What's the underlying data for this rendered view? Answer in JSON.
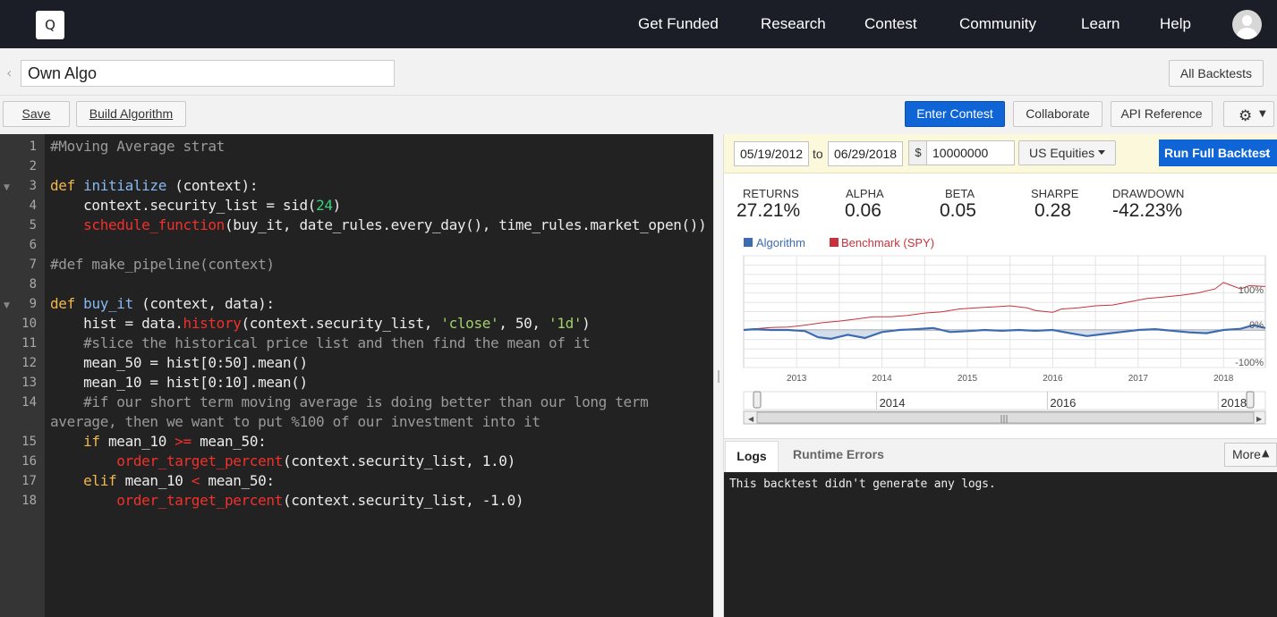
{
  "nav": {
    "logo": "Q",
    "links": [
      "Get Funded",
      "Research",
      "Contest",
      "Community",
      "Learn",
      "Help"
    ]
  },
  "title_bar": {
    "algo_name": "Own Algo",
    "all_backtests": "All Backtests"
  },
  "toolbar": {
    "save": "Save",
    "build": "Build Algorithm",
    "enter_contest": "Enter Contest",
    "collaborate": "Collaborate",
    "api_reference": "API Reference"
  },
  "editor": {
    "lines": [
      {
        "n": "1",
        "tokens": [
          [
            "cm",
            "#Moving Average strat"
          ]
        ]
      },
      {
        "n": "2",
        "tokens": []
      },
      {
        "n": "3",
        "tokens": [
          [
            "kw",
            "def"
          ],
          [
            "",
            " "
          ],
          [
            "fn",
            "initialize"
          ],
          [
            "",
            " (context):"
          ]
        ]
      },
      {
        "n": "4",
        "tokens": [
          [
            "",
            "    context.security_list = sid("
          ],
          [
            "gn",
            "24"
          ],
          [
            "",
            ")"
          ]
        ]
      },
      {
        "n": "5",
        "tokens": [
          [
            "",
            "    "
          ],
          [
            "rd",
            "schedule_function"
          ],
          [
            "",
            "(buy_it, date_rules.every_day(), time_rules.market_open())"
          ]
        ]
      },
      {
        "n": "6",
        "tokens": []
      },
      {
        "n": "7",
        "tokens": [
          [
            "cm",
            "#def make_pipeline(context)"
          ]
        ]
      },
      {
        "n": "8",
        "tokens": []
      },
      {
        "n": "9",
        "tokens": [
          [
            "kw",
            "def"
          ],
          [
            "",
            " "
          ],
          [
            "fn",
            "buy_it"
          ],
          [
            "",
            " (context, data):"
          ]
        ]
      },
      {
        "n": "10",
        "tokens": [
          [
            "",
            "    hist = data."
          ],
          [
            "rd",
            "history"
          ],
          [
            "",
            "(context.security_list, "
          ],
          [
            "st",
            "'close'"
          ],
          [
            "",
            ", 50, "
          ],
          [
            "st",
            "'1d'"
          ],
          [
            "",
            ")"
          ]
        ]
      },
      {
        "n": "11",
        "tokens": [
          [
            "cm",
            "    #slice the historical price list and then find the mean of it"
          ]
        ]
      },
      {
        "n": "12",
        "tokens": [
          [
            "",
            "    mean_50 = hist[0:50].mean()"
          ]
        ]
      },
      {
        "n": "13",
        "tokens": [
          [
            "",
            "    mean_10 = hist[0:10].mean()"
          ]
        ]
      },
      {
        "n": "14",
        "tokens": [
          [
            "cm",
            "    #if our short term moving average is doing better than our long term"
          ]
        ]
      },
      {
        "n": "",
        "tokens": [
          [
            "cm",
            "average, then we want to put %100 of our investment into it"
          ]
        ]
      },
      {
        "n": "15",
        "tokens": [
          [
            "",
            "    "
          ],
          [
            "kw",
            "if"
          ],
          [
            "",
            " mean_10 "
          ],
          [
            "rd",
            ">="
          ],
          [
            "",
            " mean_50:"
          ]
        ]
      },
      {
        "n": "16",
        "tokens": [
          [
            "",
            "        "
          ],
          [
            "rd",
            "order_target_percent"
          ],
          [
            "",
            "(context.security_list, 1.0)"
          ]
        ]
      },
      {
        "n": "17",
        "tokens": [
          [
            "",
            "    "
          ],
          [
            "kw",
            "elif"
          ],
          [
            "",
            " mean_10 "
          ],
          [
            "rd",
            "<"
          ],
          [
            "",
            " mean_50:"
          ]
        ]
      },
      {
        "n": "18",
        "tokens": [
          [
            "",
            "        "
          ],
          [
            "rd",
            "order_target_percent"
          ],
          [
            "",
            "(context.security_list, -1.0)"
          ]
        ]
      }
    ]
  },
  "backtest": {
    "start_date": "05/19/2012",
    "to_label": "to",
    "end_date": "06/29/2018",
    "currency": "$",
    "capital": "10000000",
    "universe": "US Equities",
    "run_full": "Run Full Backtest"
  },
  "metrics": [
    {
      "label": "RETURNS",
      "value": "27.21%"
    },
    {
      "label": "ALPHA",
      "value": "0.06"
    },
    {
      "label": "BETA",
      "value": "0.05"
    },
    {
      "label": "SHARPE",
      "value": "0.28"
    },
    {
      "label": "DRAWDOWN",
      "value": "-42.23%"
    }
  ],
  "chart_data": {
    "type": "line",
    "x_tick_labels": [
      "2013",
      "2014",
      "2015",
      "2016",
      "2017",
      "2018"
    ],
    "y_tick_labels": [
      "100%",
      "0%",
      "-100%"
    ],
    "ylim": [
      -100,
      130
    ],
    "xlim": [
      2012.38,
      2018.49
    ],
    "grid": true,
    "legend_position": "top-left",
    "series": [
      {
        "name": "Algorithm",
        "color": "#3d6bb0",
        "x": [
          2012.38,
          2012.5,
          2012.7,
          2012.9,
          2013.1,
          2013.25,
          2013.4,
          2013.6,
          2013.8,
          2014.0,
          2014.2,
          2014.4,
          2014.6,
          2014.8,
          2015.0,
          2015.2,
          2015.4,
          2015.6,
          2015.8,
          2016.0,
          2016.2,
          2016.4,
          2016.6,
          2016.8,
          2017.0,
          2017.2,
          2017.4,
          2017.6,
          2017.8,
          2018.0,
          2018.2,
          2018.35,
          2018.49
        ],
        "values": [
          0,
          2,
          0,
          0,
          -3,
          -18,
          -22,
          -12,
          -20,
          -5,
          0,
          2,
          5,
          -5,
          -3,
          0,
          -2,
          0,
          -2,
          0,
          -8,
          -15,
          -10,
          -5,
          0,
          2,
          -2,
          -6,
          -8,
          0,
          3,
          12,
          5
        ]
      },
      {
        "name": "Benchmark (SPY)",
        "color": "#c8323c",
        "x": [
          2012.38,
          2012.5,
          2012.7,
          2012.9,
          2013.1,
          2013.3,
          2013.5,
          2013.7,
          2013.9,
          2014.1,
          2014.3,
          2014.5,
          2014.7,
          2014.9,
          2015.1,
          2015.3,
          2015.5,
          2015.7,
          2015.8,
          2016.0,
          2016.1,
          2016.3,
          2016.5,
          2016.7,
          2016.9,
          2017.1,
          2017.3,
          2017.5,
          2017.7,
          2017.9,
          2018.0,
          2018.1,
          2018.2,
          2018.3,
          2018.49
        ],
        "values": [
          0,
          3,
          6,
          7,
          12,
          18,
          22,
          27,
          33,
          33,
          36,
          42,
          45,
          52,
          55,
          57,
          60,
          55,
          48,
          44,
          52,
          55,
          60,
          62,
          70,
          78,
          82,
          86,
          92,
          102,
          118,
          110,
          102,
          110,
          108
        ]
      }
    ],
    "navigator": {
      "labels": [
        "2014",
        "2016",
        "2018"
      ]
    }
  },
  "logs": {
    "tab_logs": "Logs",
    "tab_runtime": "Runtime Errors",
    "more": "More",
    "message": "This backtest didn't generate any logs."
  }
}
